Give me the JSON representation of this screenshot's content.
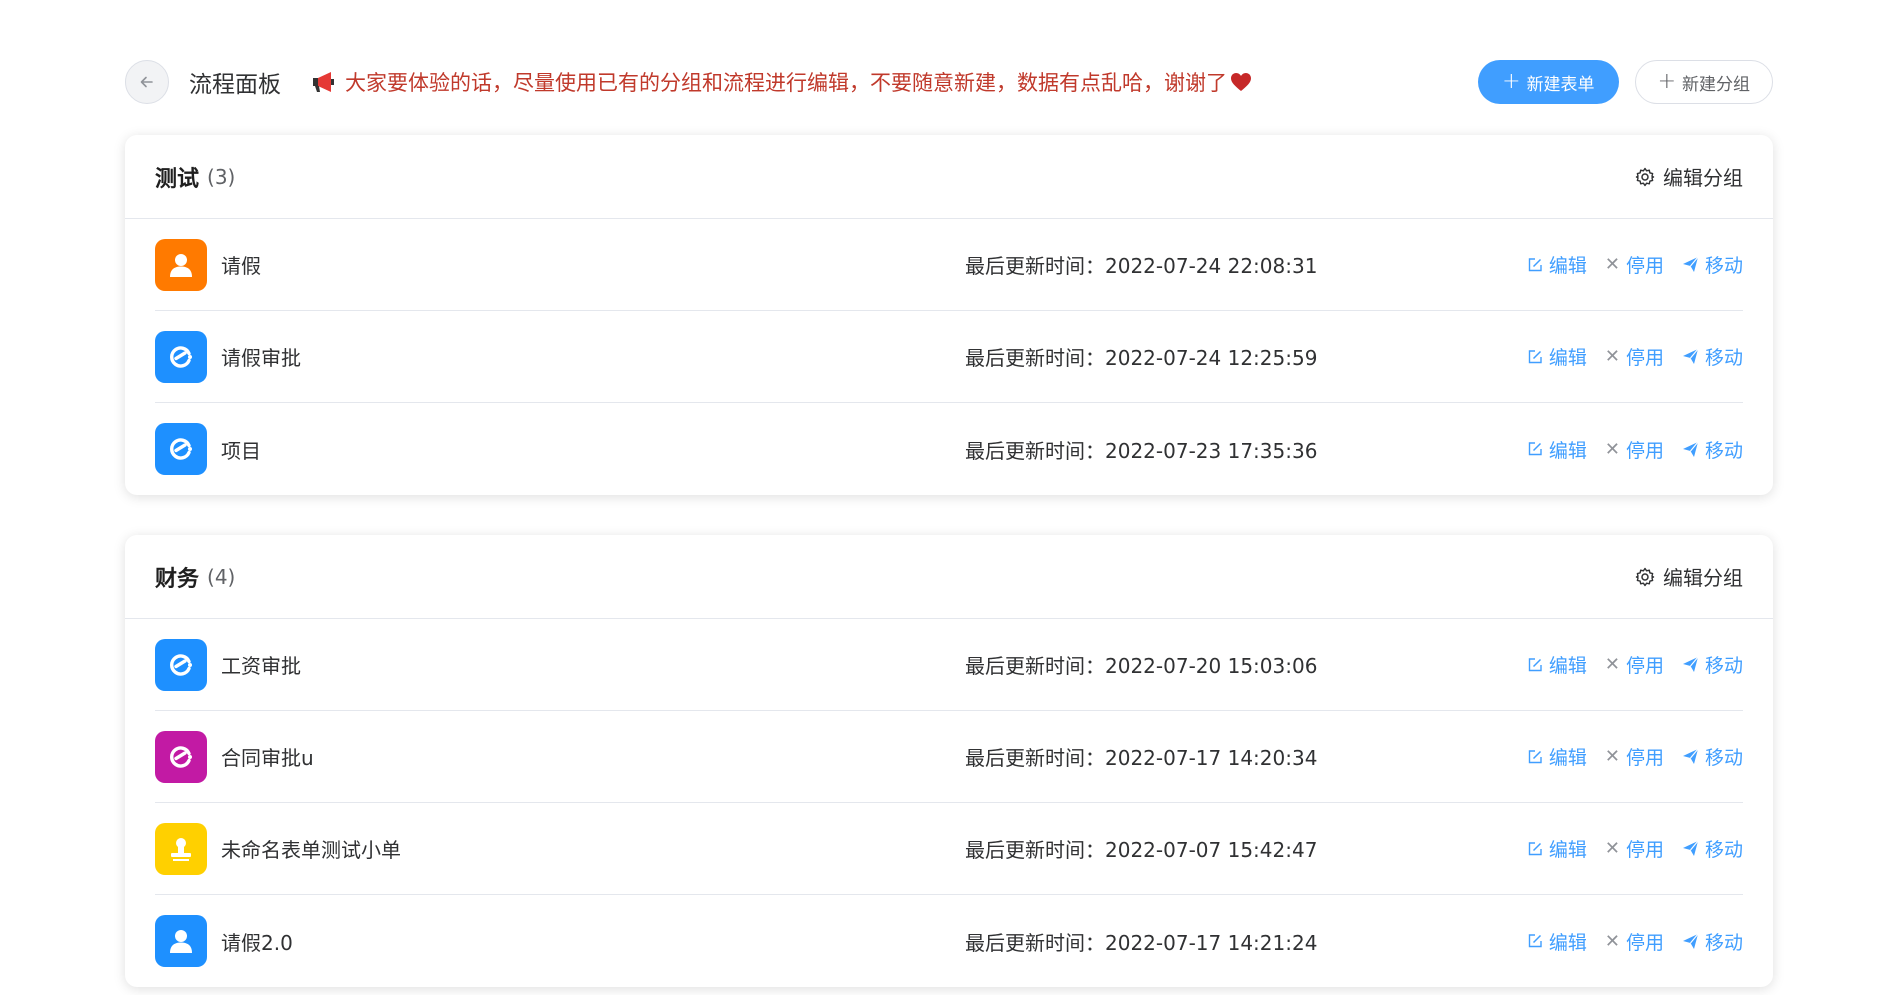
{
  "header": {
    "title": "流程面板",
    "notice": "大家要体验的话，尽量使用已有的分组和流程进行编辑，不要随意新建，数据有点乱哈，谢谢了",
    "new_form_label": "新建表单",
    "new_group_label": "新建分组"
  },
  "colors": {
    "primary": "#409eff",
    "notice": "#c0392b",
    "orange": "#ff7a00",
    "blue": "#1e90ff",
    "magenta": "#c21aa4",
    "yellow": "#ffd000"
  },
  "labels": {
    "edit_group": "编辑分组",
    "updated_prefix": "最后更新时间：",
    "edit": "编辑",
    "disable": "停用",
    "move": "移动"
  },
  "groups": [
    {
      "name": "测试",
      "count": "(3)",
      "items": [
        {
          "name": "请假",
          "updated": "2022-07-24 22:08:31",
          "icon": "user-icon",
          "color": "orange"
        },
        {
          "name": "请假审批",
          "updated": "2022-07-24 12:25:59",
          "icon": "flow-icon",
          "color": "blue"
        },
        {
          "name": "项目",
          "updated": "2022-07-23 17:35:36",
          "icon": "flow-icon",
          "color": "blue"
        }
      ]
    },
    {
      "name": "财务",
      "count": "(4)",
      "items": [
        {
          "name": "工资审批",
          "updated": "2022-07-20 15:03:06",
          "icon": "flow-icon",
          "color": "blue"
        },
        {
          "name": "合同审批u",
          "updated": "2022-07-17 14:20:34",
          "icon": "flow-icon",
          "color": "magenta"
        },
        {
          "name": "未命名表单测试小单",
          "updated": "2022-07-07 15:42:47",
          "icon": "stamp-icon",
          "color": "yellow"
        },
        {
          "name": "请假2.0",
          "updated": "2022-07-17 14:21:24",
          "icon": "user-icon",
          "color": "blue"
        }
      ]
    }
  ]
}
